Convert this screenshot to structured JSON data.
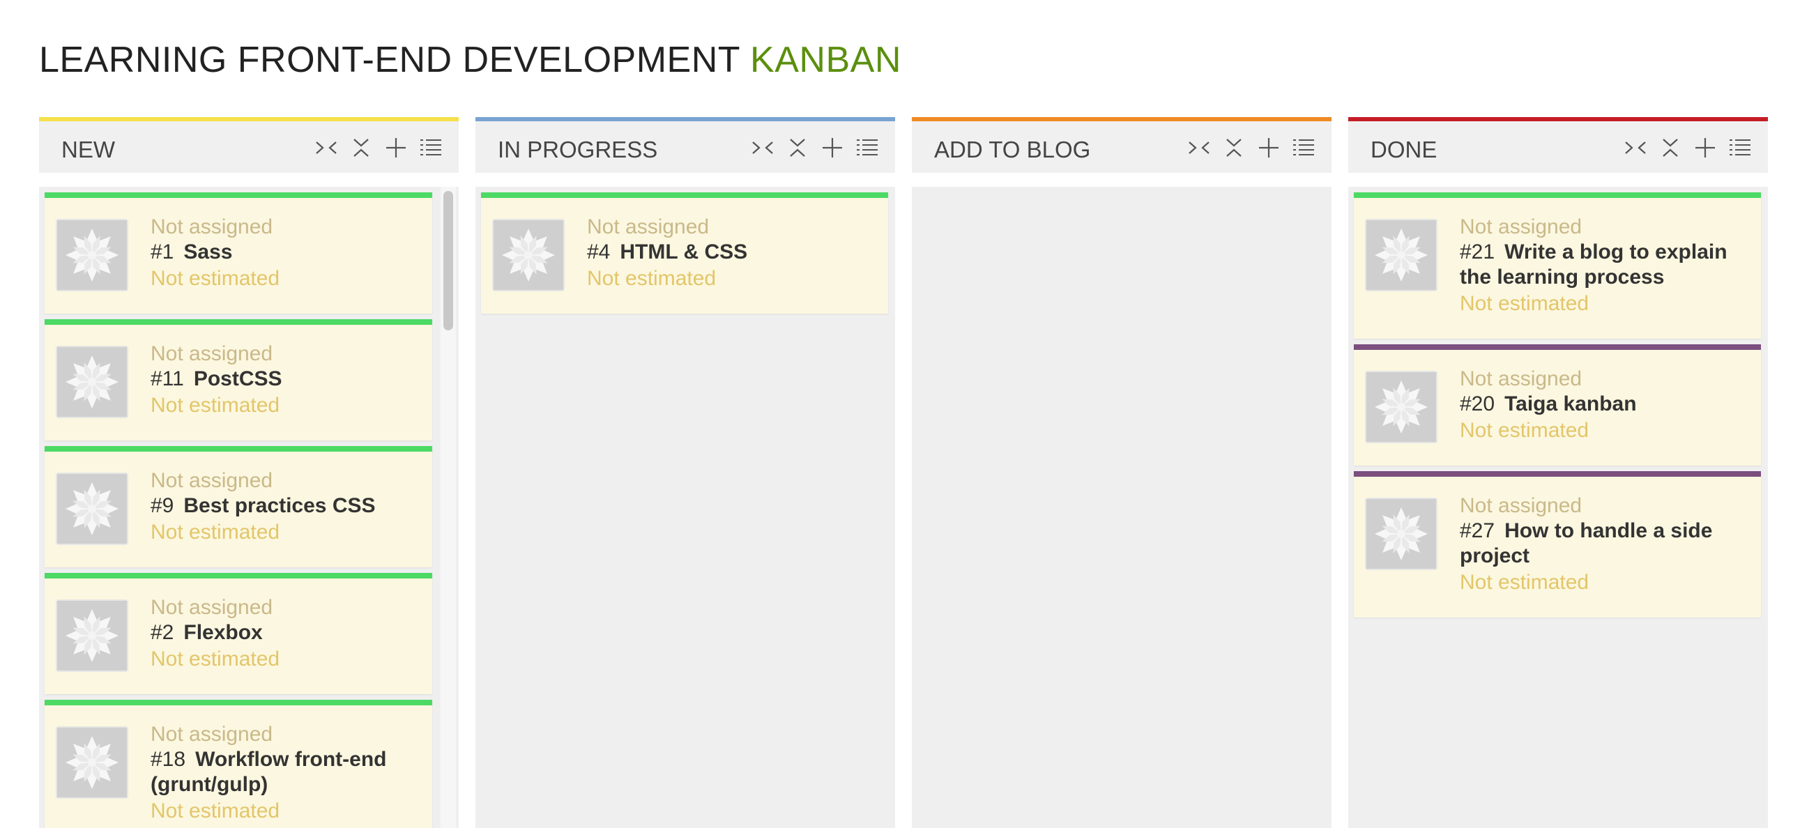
{
  "title": {
    "main": "LEARNING FRONT-END DEVELOPMENT",
    "accent": "KANBAN"
  },
  "colors": {
    "accent": "#5b8f0d",
    "card_bg": "#fcf7e0",
    "col_new": "#f5e04a",
    "col_in_progress": "#78a3d4",
    "col_add_to_blog": "#f08a24",
    "col_done": "#c51d25",
    "card_green": "#4cd964",
    "card_purple": "#7b4f7e"
  },
  "columns": [
    {
      "name": "NEW",
      "color": "#f5e04a",
      "actions": [
        "fold-icon",
        "collapse-icon",
        "add-icon",
        "list-icon"
      ],
      "cards": [
        {
          "assigned": "Not assigned",
          "ref": "#1",
          "subject": "Sass",
          "estimate": "Not estimated",
          "color": "#4cd964"
        },
        {
          "assigned": "Not assigned",
          "ref": "#11",
          "subject": "PostCSS",
          "estimate": "Not estimated",
          "color": "#4cd964"
        },
        {
          "assigned": "Not assigned",
          "ref": "#9",
          "subject": "Best practices CSS",
          "estimate": "Not estimated",
          "color": "#4cd964"
        },
        {
          "assigned": "Not assigned",
          "ref": "#2",
          "subject": "Flexbox",
          "estimate": "Not estimated",
          "color": "#4cd964"
        },
        {
          "assigned": "Not assigned",
          "ref": "#18",
          "subject": "Workflow front-end (grunt/gulp)",
          "estimate": "Not estimated",
          "color": "#4cd964"
        }
      ]
    },
    {
      "name": "IN PROGRESS",
      "color": "#78a3d4",
      "actions": [
        "fold-icon",
        "collapse-icon",
        "add-icon",
        "list-icon"
      ],
      "cards": [
        {
          "assigned": "Not assigned",
          "ref": "#4",
          "subject": "HTML & CSS",
          "estimate": "Not estimated",
          "color": "#4cd964"
        }
      ]
    },
    {
      "name": "ADD TO BLOG",
      "color": "#f08a24",
      "actions": [
        "fold-icon",
        "collapse-icon",
        "add-icon",
        "list-icon"
      ],
      "cards": []
    },
    {
      "name": "DONE",
      "color": "#c51d25",
      "actions": [
        "fold-icon",
        "collapse-icon",
        "add-icon",
        "list-icon"
      ],
      "cards": [
        {
          "assigned": "Not assigned",
          "ref": "#21",
          "subject": "Write a blog to explain the learning process",
          "estimate": "Not estimated",
          "color": "#4cd964"
        },
        {
          "assigned": "Not assigned",
          "ref": "#20",
          "subject": "Taiga kanban",
          "estimate": "Not estimated",
          "color": "#7b4f7e"
        },
        {
          "assigned": "Not assigned",
          "ref": "#27",
          "subject": "How to handle a side project",
          "estimate": "Not estimated",
          "color": "#7b4f7e"
        }
      ]
    }
  ]
}
